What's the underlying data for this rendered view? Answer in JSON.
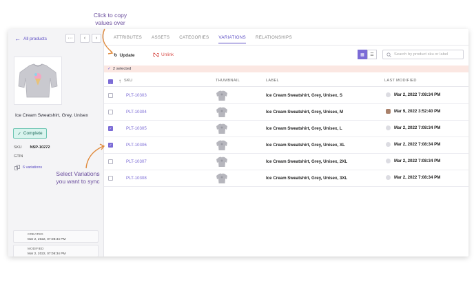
{
  "annotations": {
    "top": [
      "Click to copy",
      "values over"
    ],
    "bottom": [
      "Select Variations",
      "you want to sync"
    ]
  },
  "sidebar": {
    "back_label": "All products",
    "more_label": "···",
    "prev_label": "‹",
    "next_label": "›",
    "product_name": "Ice Cream Sweatshirt, Grey, Unisex",
    "status_label": "Complete",
    "sku_key": "SKU",
    "sku_value": "NSP-10272",
    "gtin_key": "GTIN",
    "variations_label": "6 variations",
    "created_label": "CREATED",
    "created_value": "Mar 2, 2022, 07:08:34 PM",
    "modified_label": "MODIFIED",
    "modified_value": "Mar 2, 2022, 07:08:34 PM"
  },
  "tabs": [
    "ATTRIBUTES",
    "ASSETS",
    "CATEGORIES",
    "VARIATIONS",
    "RELATIONSHIPS"
  ],
  "active_tab": "VARIATIONS",
  "toolbar": {
    "update_label": "Update",
    "unlink_label": "Unlink",
    "search_placeholder": "Search by product sku or label"
  },
  "selection": {
    "label": "2 selected"
  },
  "table": {
    "headers": {
      "sku": "SKU",
      "thumbnail": "THUMBNAIL",
      "label": "LABEL",
      "modified": "LAST MODIFIED"
    },
    "rows": [
      {
        "sku": "PLT-10303",
        "label": "Ice Cream Sweatshirt, Grey, Unisex, S",
        "modified": "Mar 2, 2022 7:08:34 PM",
        "checked": false,
        "avatar": "placeholder"
      },
      {
        "sku": "PLT-10304",
        "label": "Ice Cream Sweatshirt, Grey, Unisex, M",
        "modified": "Mar 9, 2022 3:52:40 PM",
        "checked": false,
        "avatar": "photo"
      },
      {
        "sku": "PLT-10305",
        "label": "Ice Cream Sweatshirt, Grey, Unisex, L",
        "modified": "Mar 2, 2022 7:08:34 PM",
        "checked": true,
        "avatar": "placeholder"
      },
      {
        "sku": "PLT-10306",
        "label": "Ice Cream Sweatshirt, Grey, Unisex, XL",
        "modified": "Mar 2, 2022 7:08:34 PM",
        "checked": true,
        "avatar": "placeholder"
      },
      {
        "sku": "PLT-10307",
        "label": "Ice Cream Sweatshirt, Grey, Unisex, 2XL",
        "modified": "Mar 2, 2022 7:08:34 PM",
        "checked": false,
        "avatar": "placeholder"
      },
      {
        "sku": "PLT-10308",
        "label": "Ice Cream Sweatshirt, Grey, Unisex, 3XL",
        "modified": "Mar 2, 2022 7:08:34 PM",
        "checked": false,
        "avatar": "placeholder"
      }
    ]
  },
  "colors": {
    "accent": "#7b6bd6",
    "annotation": "#6a4d9d",
    "unlink": "#d9534f",
    "complete_bg": "#d9f4ee"
  }
}
